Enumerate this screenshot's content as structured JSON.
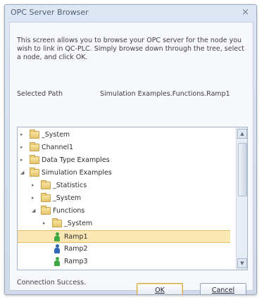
{
  "window": {
    "title": "OPC Server Browser",
    "close_icon": "×"
  },
  "description": "This screen allows you to browse your OPC server for the node you wish to link in QC-PLC. Simply browse down through the tree, select a node, and click OK.",
  "selected_path": {
    "label": "Selected Path",
    "value": "Simulation Examples.Functions.Ramp1"
  },
  "tree": {
    "items": [
      {
        "label": "_System",
        "expanded": false,
        "kind": "folder",
        "depth": 0
      },
      {
        "label": "Channel1",
        "expanded": false,
        "kind": "folder",
        "depth": 0
      },
      {
        "label": "Data Type Examples",
        "expanded": false,
        "kind": "folder",
        "depth": 0
      },
      {
        "label": "Simulation Examples",
        "expanded": true,
        "kind": "folder",
        "depth": 0
      },
      {
        "label": "_Statistics",
        "expanded": false,
        "kind": "folder",
        "depth": 1
      },
      {
        "label": "_System",
        "expanded": false,
        "kind": "folder",
        "depth": 1
      },
      {
        "label": "Functions",
        "expanded": true,
        "kind": "folder",
        "depth": 1
      },
      {
        "label": "_System",
        "expanded": false,
        "kind": "folder",
        "depth": 2
      },
      {
        "label": "Ramp1",
        "selected": true,
        "kind": "tag-green",
        "depth": 2
      },
      {
        "label": "Ramp2",
        "kind": "tag-blue",
        "depth": 2
      },
      {
        "label": "Ramp3",
        "kind": "tag-green",
        "depth": 2
      }
    ]
  },
  "status": "Connection Success.",
  "buttons": {
    "ok_label": "OK",
    "cancel_label": "Cancel"
  },
  "icons": {
    "collapsed": "▸",
    "expanded": "◢",
    "scroll_up": "▲",
    "scroll_down": "▼"
  },
  "colors": {
    "selection": "#fbe7b4",
    "accent_border": "#e6be63"
  }
}
